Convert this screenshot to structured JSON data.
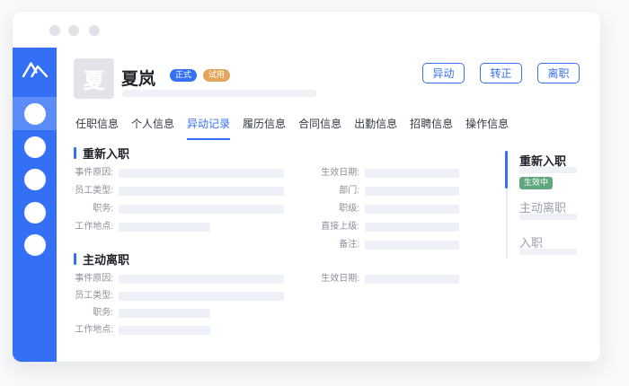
{
  "colors": {
    "accent": "#3370f6",
    "badge_regular_bg": "#3370f6",
    "badge_probation_bg": "#e2a65a",
    "badge_effective_bg": "#61a77d",
    "placeholder_bar": "#edf0f7"
  },
  "header": {
    "avatar_text": "夏",
    "name": "夏岚",
    "badges": [
      {
        "label": "正式"
      },
      {
        "label": "试用"
      }
    ],
    "actions": [
      {
        "label": "异动"
      },
      {
        "label": "转正"
      },
      {
        "label": "离职"
      }
    ]
  },
  "tabs": [
    {
      "label": "任职信息",
      "active": false
    },
    {
      "label": "个人信息",
      "active": false
    },
    {
      "label": "异动记录",
      "active": true
    },
    {
      "label": "履历信息",
      "active": false
    },
    {
      "label": "合同信息",
      "active": false
    },
    {
      "label": "出勤信息",
      "active": false
    },
    {
      "label": "招聘信息",
      "active": false
    },
    {
      "label": "操作信息",
      "active": false
    }
  ],
  "sections": [
    {
      "title": "重新入职",
      "left_fields": [
        "事件原因:",
        "员工类型:",
        "职务:",
        "工作地点:"
      ],
      "right_fields": [
        "生效日期:",
        "部门:",
        "职级:",
        "直接上级:",
        "备注:"
      ]
    },
    {
      "title": "主动离职",
      "left_fields": [
        "事件原因:",
        "员工类型:",
        "职务:",
        "工作地点:"
      ],
      "right_fields": [
        "生效日期:"
      ]
    }
  ],
  "timeline": [
    {
      "title": "重新入职",
      "badge": "生效中",
      "active": true
    },
    {
      "title": "主动离职",
      "active": false
    },
    {
      "title": "入职",
      "active": false
    }
  ]
}
